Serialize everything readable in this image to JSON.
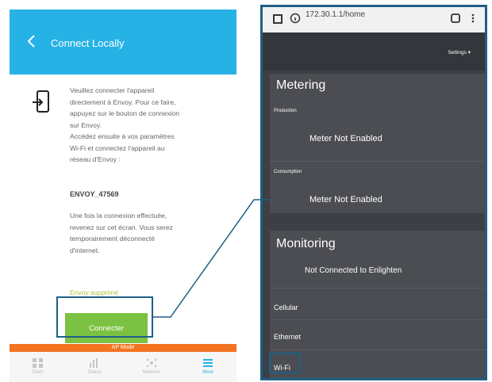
{
  "left": {
    "header": {
      "title": "Connect Locally"
    },
    "instructions": [
      "Veuillez connecter l'appareil",
      "directement à Envoy. Pour ce faire,",
      "appuyez sur le bouton de connexion",
      "sur Envoy.",
      "Accédez ensuite à vos paramètres",
      "Wi-Fi et connectez l'appareil au",
      "réseau d'Envoy :"
    ],
    "ssid": "ENVOY_47569",
    "after_text": [
      "Une fois la connexion effectuée,",
      "revenez sur cet écran. Vous serez",
      "temporairement déconnecté",
      "d'internet."
    ],
    "status": "Envoy supprimé",
    "connect_button": "Connecter",
    "ap_mode": "AP Mode",
    "nav": [
      {
        "label": "Dash",
        "icon": "dashboard-icon"
      },
      {
        "label": "Status",
        "icon": "bar-chart-icon"
      },
      {
        "label": "Network",
        "icon": "network-icon"
      },
      {
        "label": "More",
        "icon": "menu-icon"
      }
    ]
  },
  "right": {
    "url": "172.30.1.1/home",
    "settings_label": "Settings ▾",
    "metering": {
      "title": "Metering",
      "production_label": "Production",
      "production_value": "Meter Not Enabled",
      "consumption_label": "Consumption",
      "consumption_value": "Meter Not Enabled"
    },
    "monitoring": {
      "title": "Monitoring",
      "status": "Not Connected to Enlighten",
      "rows": [
        "Cellular",
        "Ethernet",
        "Wi-Fi"
      ]
    }
  },
  "colors": {
    "header_blue": "#27b2e6",
    "button_green": "#7cc242",
    "ap_orange": "#f37321",
    "highlight_blue": "#1e5f86",
    "dark_panel": "#4b4d53"
  }
}
